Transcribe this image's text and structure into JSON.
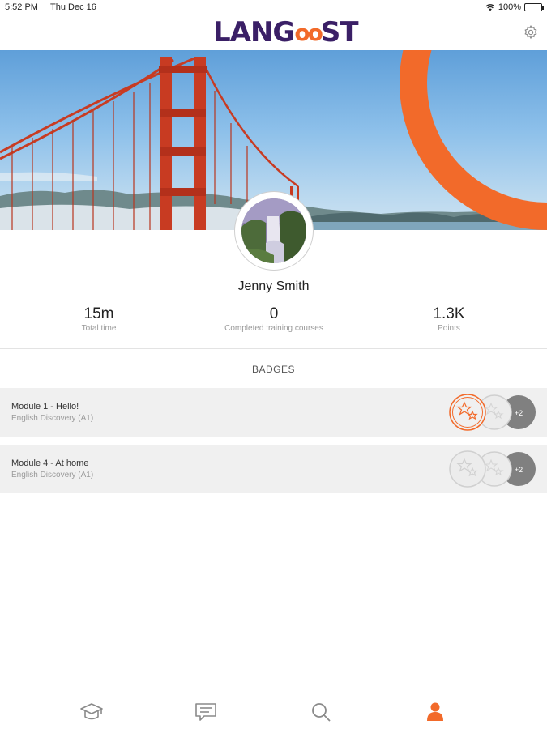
{
  "status_bar": {
    "time": "5:52 PM",
    "date": "Thu Dec 16",
    "battery": "100%"
  },
  "header": {
    "logo": {
      "prefix": "LANG",
      "oo": "oo",
      "suffix": "ST"
    },
    "icons": [
      "gear-icon"
    ]
  },
  "profile": {
    "name": "Jenny Smith",
    "stats": [
      {
        "value": "15m",
        "label": "Total time"
      },
      {
        "value": "0",
        "label": "Completed training courses"
      },
      {
        "value": "1.3K",
        "label": "Points"
      }
    ]
  },
  "badges": {
    "title": "BADGES",
    "items": [
      {
        "title": "Module 1 - Hello!",
        "subtitle": "English Discovery (A1)",
        "first_earned": true,
        "extra": "+2"
      },
      {
        "title": "Module 4 - At home",
        "subtitle": "English Discovery (A1)",
        "first_earned": false,
        "extra": "+2"
      }
    ]
  },
  "bottom_nav": [
    {
      "name": "courses",
      "icon": "graduation-cap-icon",
      "active": false
    },
    {
      "name": "messages",
      "icon": "chat-icon",
      "active": false
    },
    {
      "name": "search",
      "icon": "search-icon",
      "active": false
    },
    {
      "name": "profile",
      "icon": "person-icon",
      "active": true
    }
  ],
  "colors": {
    "accent": "#f26a2a",
    "brand": "#3a1f66",
    "inactive": "#9a9a9a",
    "row_bg": "#f0f0f0"
  }
}
